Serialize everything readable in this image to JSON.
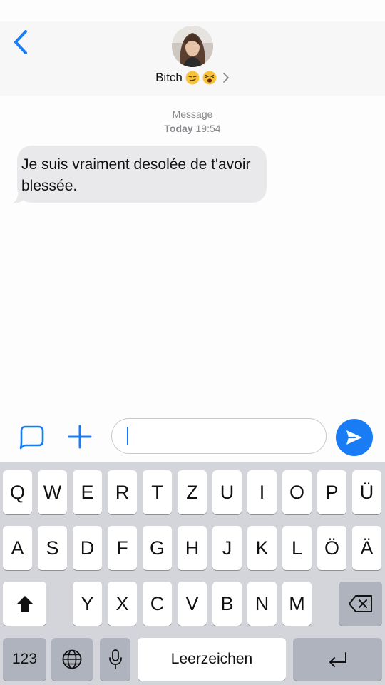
{
  "contact": {
    "name": "Bitch",
    "emojis": [
      "smirk-face-emoji",
      "tired-face-emoji"
    ]
  },
  "thread": {
    "service_label": "Message",
    "date_label": "Today",
    "time_label": "19:54"
  },
  "messages": [
    {
      "text": " Je suis vraiment desolée de t'avoir blessée.",
      "direction": "incoming"
    }
  ],
  "composer": {
    "value": "",
    "placeholder": ""
  },
  "keyboard": {
    "row1": [
      "Q",
      "W",
      "E",
      "R",
      "T",
      "Z",
      "U",
      "I",
      "O",
      "P",
      "Ü"
    ],
    "row2": [
      "A",
      "S",
      "D",
      "F",
      "G",
      "H",
      "J",
      "K",
      "L",
      "Ö",
      "Ä"
    ],
    "row3": [
      "Y",
      "X",
      "C",
      "V",
      "B",
      "N",
      "M"
    ],
    "numbers_label": "123",
    "space_label": "Leerzeichen"
  },
  "colors": {
    "accent": "#1a7cf5",
    "incoming_bubble": "#e9e9eb",
    "keyboard_bg": "#d3d5db",
    "special_key": "#aeb3be"
  }
}
